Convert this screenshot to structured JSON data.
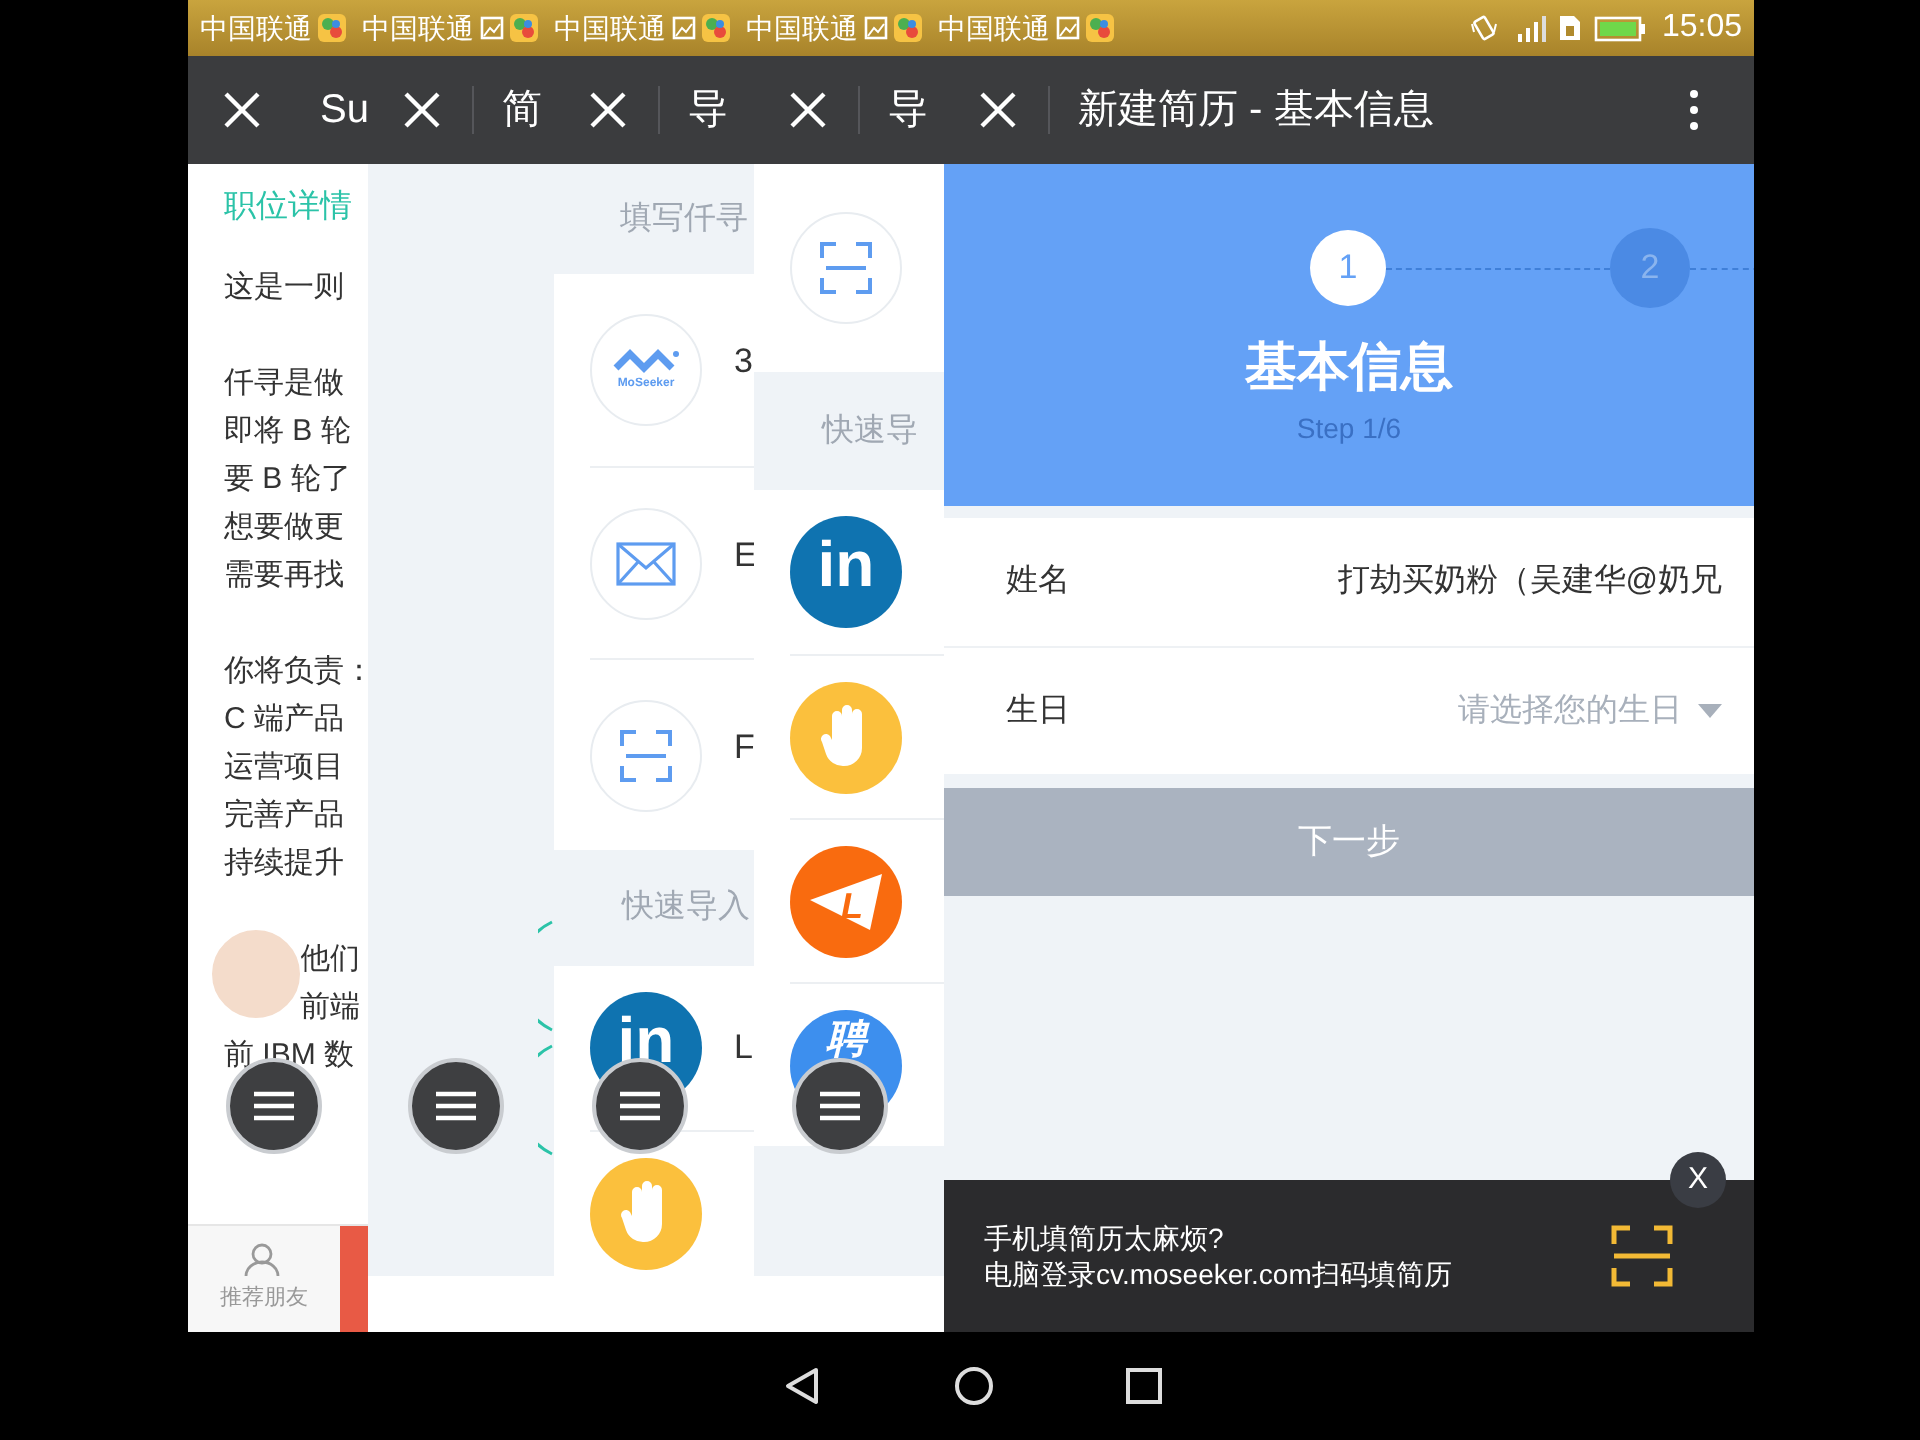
{
  "status_bar": {
    "carriers": [
      "中国联通",
      "中国联通",
      "中国联通",
      "中国联通",
      "中国联通"
    ],
    "time": "15:05"
  },
  "panels": [
    {
      "kind": "job",
      "tab_title": "Su",
      "heading": "职位详情",
      "paragraphs": [
        [
          "这是一则"
        ],
        [
          "仟寻是做",
          "即将 B 轮",
          "要 B 轮了",
          "想要做更",
          "需要再找"
        ],
        [
          "你将负责：",
          "C 端产品",
          "运营项目",
          "完善产品",
          "持续提升"
        ],
        [
          "他们",
          "前端",
          "前 IBM 数"
        ]
      ],
      "bottom_tab": "推荐朋友"
    },
    {
      "kind": "blank",
      "tab_title": "简"
    },
    {
      "kind": "import",
      "tab_title": "导",
      "header": "填写仟寻",
      "options": [
        {
          "kind": "moseeker",
          "logo_text": "MoSeeker",
          "label": "3"
        },
        {
          "kind": "mail",
          "label": "E"
        },
        {
          "kind": "scan",
          "label": "F"
        }
      ],
      "section": "快速导入",
      "quick": [
        {
          "kind": "linkedin",
          "badge": "in",
          "label": "L"
        },
        {
          "kind": "hand"
        }
      ]
    },
    {
      "kind": "import",
      "tab_title": "导",
      "options": [
        {
          "kind": "scan"
        }
      ],
      "section": "快速导",
      "quick": [
        {
          "kind": "linkedin",
          "badge": "in"
        },
        {
          "kind": "hand"
        },
        {
          "kind": "liepin",
          "badge": "L"
        },
        {
          "kind": "zhaopin",
          "badge": "聘"
        }
      ]
    },
    {
      "kind": "form",
      "tab_title": "新建简历 - 基本信息",
      "steps": [
        {
          "label": "1",
          "selected": true
        },
        {
          "label": "2",
          "selected": false
        }
      ],
      "title": "基本信息",
      "subtitle": "Step 1/6",
      "fields": [
        {
          "kind": "text",
          "label": "姓名",
          "value": "打劫买奶粉（吴建华@奶兄"
        },
        {
          "kind": "select",
          "label": "生日",
          "placeholder": "请选择您的生日"
        }
      ],
      "button": {
        "label": "下一步",
        "disabled": true
      },
      "banner": {
        "lines": [
          "手机填简历太麻烦?",
          "电脑登录cv.moseeker.com扫码填简历"
        ],
        "close": "X"
      }
    }
  ]
}
